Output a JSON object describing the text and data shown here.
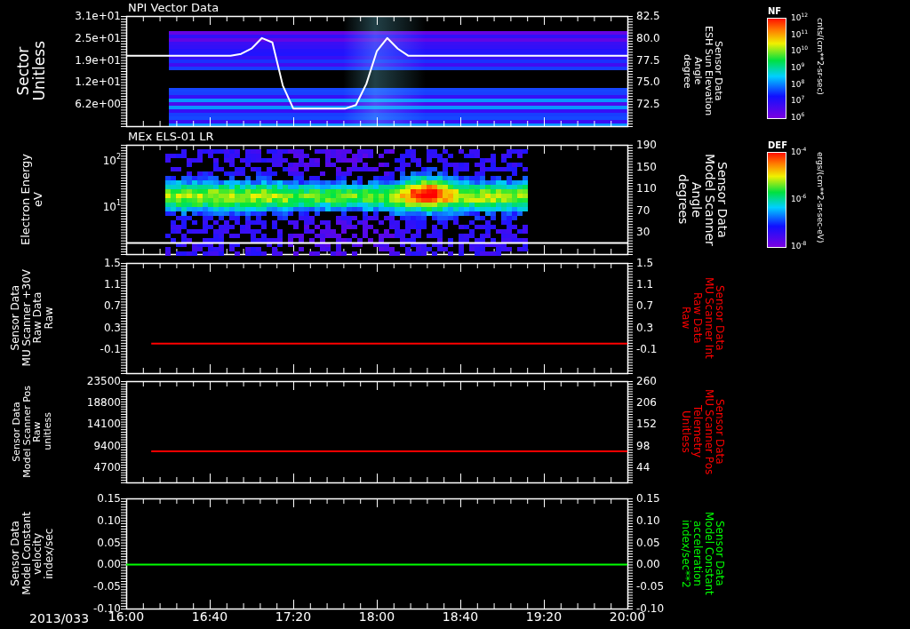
{
  "panels": [
    {
      "kind": "spectrogram",
      "title": "NPI Vector Data",
      "left_title": "Sector\nUnitless",
      "left_ticks": [
        "3.1e+01",
        "2.5e+01",
        "1.9e+01",
        "1.2e+01",
        "6.2e+00"
      ],
      "chart_data": {
        "type": "line",
        "ylabel": "Sensor Data\nESH Sun Elevation\nAngle\ndegree",
        "categories": [
          null,
          null,
          null,
          null,
          null,
          null,
          null,
          null,
          null,
          null,
          null,
          null,
          null,
          null,
          null,
          null,
          null,
          null,
          null,
          null,
          null,
          null,
          null,
          null,
          null,
          null,
          null,
          null,
          null,
          null,
          null,
          null,
          null,
          null,
          null,
          null,
          null,
          null,
          null,
          null,
          null,
          null,
          null,
          null,
          null,
          null,
          null,
          null,
          null
        ],
        "ylim": [
          70,
          82.5
        ],
        "yticks": [
          {
            "value": 82.5,
            "label": "82.5"
          },
          {
            "value": 80,
            "label": "80.0"
          },
          {
            "value": 77.5,
            "label": "77.5"
          },
          {
            "value": 75,
            "label": "75.0"
          },
          {
            "value": 72.5,
            "label": "72.5"
          }
        ],
        "series": [
          {
            "color": "#ffffff",
            "values": [
              78,
              78,
              78,
              78,
              78,
              78,
              78,
              78,
              78,
              78,
              78,
              78.2,
              78.8,
              80,
              79.5,
              74.6,
              72,
              72,
              72,
              72,
              72,
              72,
              72.4,
              74.8,
              78.5,
              80,
              78.8,
              78,
              78,
              78,
              78,
              78,
              78,
              78,
              78,
              78,
              78,
              78,
              78,
              78,
              78,
              78,
              78,
              78,
              78,
              78,
              78,
              78,
              78
            ]
          }
        ]
      },
      "colorbar": {
        "label": "NF",
        "ticks": [
          "10$^{12}$",
          "10$^{11}$",
          "10$^{10}$",
          "10$^{9}$",
          "10$^{8}$",
          "10$^{7}$",
          "10$^{6}$"
        ],
        "units": "cnts/(cm**2-sr-sec)"
      }
    },
    {
      "kind": "spectrogram",
      "title": "MEx ELS-01 LR",
      "left_title": "Electron Energy\neV",
      "left_ticks": [
        "10$^{2}$",
        "10$^{1}$"
      ],
      "right_title": "Sensor Data\nModel Scanner\nAngle\ndegrees",
      "right_ticks": [
        "190",
        "150",
        "110",
        "70",
        "30"
      ],
      "colorbar": {
        "label": "DEF",
        "ticks": [
          "10$^{-4}$",
          "10$^{-6}$",
          "10$^{-8}$"
        ],
        "units": "ergs/(cm**2-sr-sec-eV)"
      }
    },
    {
      "kind": "line",
      "left_title": "Sensor Data\nMU Scanner +30V\nRaw Data\nRaw",
      "left_ticks": [
        "1.5",
        "1.1",
        "0.7",
        "0.3",
        "-0.1"
      ],
      "chart_data": {
        "type": "line",
        "ylabel": "Sensor Data\nMU Scanner Int\nRaw Data\nRaw",
        "categories": [
          null,
          null,
          null,
          null,
          null,
          null,
          null,
          null,
          null,
          null,
          null,
          null,
          null,
          null,
          null,
          null,
          null,
          null,
          null,
          null,
          null
        ],
        "ylim": [
          -0.55,
          1.5
        ],
        "yticks": [
          {
            "value": 1.5,
            "label": "1.5"
          },
          {
            "value": 1.1,
            "label": "1.1"
          },
          {
            "value": 0.7,
            "label": "0.7"
          },
          {
            "value": 0.3,
            "label": "0.3"
          },
          {
            "value": -0.1,
            "label": "-0.1"
          }
        ],
        "series": [
          {
            "color": "#ff0000",
            "values": [
              null,
              0,
              0,
              0,
              0,
              0,
              0,
              0,
              0,
              0,
              0,
              0,
              0,
              0,
              0,
              0,
              0,
              0,
              0,
              0,
              0
            ]
          }
        ]
      }
    },
    {
      "kind": "line",
      "left_title": "Sensor Data\nModel Scanner Pos\nRaw\nunitless",
      "left_ticks": [
        "23500",
        "18800",
        "14100",
        "9400",
        "4700"
      ],
      "chart_data": {
        "type": "line",
        "ylabel": "Sensor Data\nMU Scanner Pos\nTelemetry\nUnitless",
        "categories": [
          null,
          null,
          null,
          null,
          null,
          null,
          null,
          null,
          null,
          null,
          null,
          null,
          null,
          null,
          null,
          null,
          null,
          null,
          null,
          null,
          null
        ],
        "ylim": [
          6,
          260
        ],
        "yticks": [
          {
            "value": 260,
            "label": "260"
          },
          {
            "value": 206,
            "label": "206"
          },
          {
            "value": 152,
            "label": "152"
          },
          {
            "value": 98,
            "label": "98"
          },
          {
            "value": 44,
            "label": "44"
          }
        ],
        "series": [
          {
            "color": "#ff0000",
            "values": [
              null,
              84,
              84,
              84,
              84,
              84,
              84,
              84,
              84,
              84,
              84,
              84,
              84,
              84,
              84,
              84,
              84,
              84,
              84,
              84,
              84
            ]
          }
        ]
      }
    },
    {
      "kind": "line",
      "left_title": "Sensor Data\nModel Constant\nvelocity\nindex/sec",
      "left_ticks": [
        "0.15",
        "0.10",
        "0.05",
        "0.00",
        "-0.05",
        "-0.10"
      ],
      "chart_data": {
        "type": "line",
        "ylabel": "Sensor Data\nModel Constant\nacceleration\nindex/sec**2",
        "categories": [
          "16:00",
          "16:40",
          "17:20",
          "18:00",
          "18:40",
          "19:20",
          "20:00"
        ],
        "ylim": [
          -0.1,
          0.15
        ],
        "yticks": [
          {
            "value": 0.15,
            "label": "0.15"
          },
          {
            "value": 0.1,
            "label": "0.10"
          },
          {
            "value": 0.05,
            "label": "0.05"
          },
          {
            "value": 0,
            "label": "0.00"
          },
          {
            "value": -0.05,
            "label": "-0.05"
          },
          {
            "value": -0.1,
            "label": "-0.10"
          }
        ],
        "series": [
          {
            "color": "#00ff00",
            "values": [
              0,
              0,
              0,
              0,
              0,
              0,
              0
            ]
          }
        ]
      }
    }
  ],
  "time_axis": {
    "date": "2013/033"
  }
}
